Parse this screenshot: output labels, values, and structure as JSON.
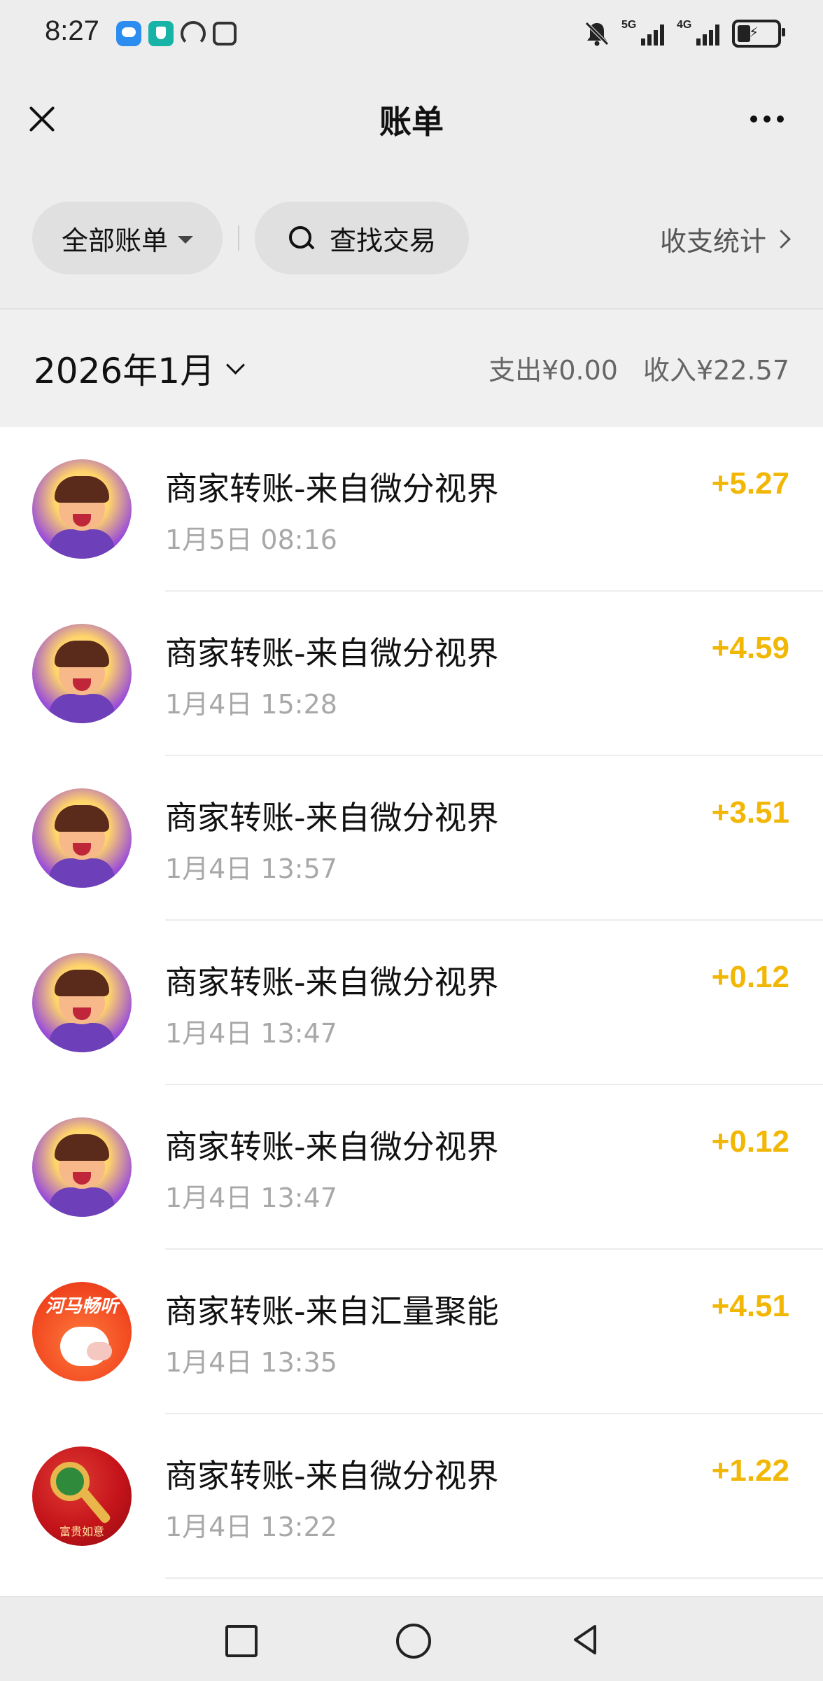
{
  "status_bar": {
    "time": "8:27",
    "network_1": "5G",
    "network_2": "4G"
  },
  "header": {
    "title": "账单"
  },
  "filters": {
    "all_bills_label": "全部账单",
    "search_label": "查找交易",
    "stats_label": "收支统计"
  },
  "month_summary": {
    "month": "2026年1月",
    "expense": "支出¥0.00",
    "income": "收入¥22.57"
  },
  "transactions": [
    {
      "title": "商家转账-来自微分视界",
      "time": "1月5日 08:16",
      "amount": "+5.27",
      "avatar": "character-avatar"
    },
    {
      "title": "商家转账-来自微分视界",
      "time": "1月4日 15:28",
      "amount": "+4.59",
      "avatar": "character-avatar"
    },
    {
      "title": "商家转账-来自微分视界",
      "time": "1月4日 13:57",
      "amount": "+3.51",
      "avatar": "character-avatar"
    },
    {
      "title": "商家转账-来自微分视界",
      "time": "1月4日 13:47",
      "amount": "+0.12",
      "avatar": "character-avatar"
    },
    {
      "title": "商家转账-来自微分视界",
      "time": "1月4日 13:47",
      "amount": "+0.12",
      "avatar": "character-avatar"
    },
    {
      "title": "商家转账-来自汇量聚能",
      "time": "1月4日 13:35",
      "amount": "+4.51",
      "avatar": "hippo-avatar",
      "avatar_text": "河马畅听"
    },
    {
      "title": "商家转账-来自微分视界",
      "time": "1月4日 13:22",
      "amount": "+1.22",
      "avatar": "key-avatar",
      "avatar_text": "富贵如意"
    }
  ],
  "colors": {
    "amount": "#f2b705",
    "background": "#ededed"
  }
}
